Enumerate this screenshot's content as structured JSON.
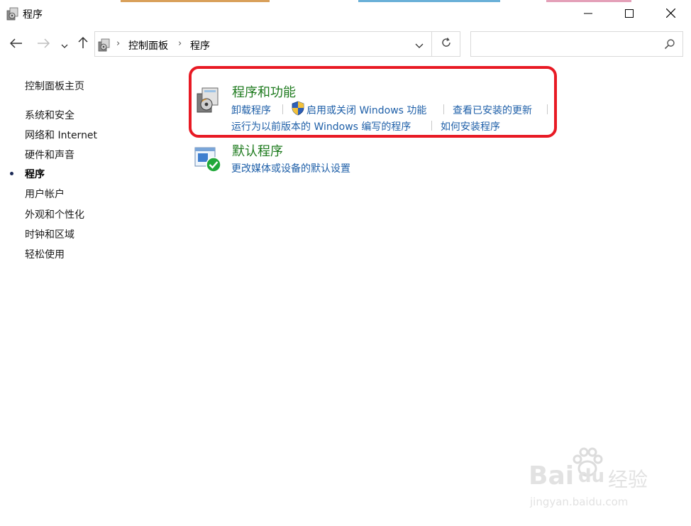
{
  "window": {
    "title": "程序"
  },
  "titlebar": {
    "minimize_icon": "minimize-icon",
    "maximize_icon": "maximize-icon",
    "close_icon": "close-icon"
  },
  "navbar": {
    "breadcrumbs": [
      "控制面板",
      "程序"
    ],
    "search_placeholder": ""
  },
  "sidebar": {
    "home": "控制面板主页",
    "items": [
      {
        "label": "系统和安全",
        "active": false
      },
      {
        "label": "网络和 Internet",
        "active": false
      },
      {
        "label": "硬件和声音",
        "active": false
      },
      {
        "label": "程序",
        "active": true
      },
      {
        "label": "用户帐户",
        "active": false
      },
      {
        "label": "外观和个性化",
        "active": false
      },
      {
        "label": "时钟和区域",
        "active": false
      },
      {
        "label": "轻松使用",
        "active": false
      }
    ]
  },
  "main": {
    "programs_features": {
      "title": "程序和功能",
      "links": [
        "卸载程序",
        "启用或关闭 Windows 功能",
        "查看已安装的更新",
        "运行为以前版本的 Windows 编写的程序",
        "如何安装程序"
      ]
    },
    "default_programs": {
      "title": "默认程序",
      "links": [
        "更改媒体或设备的默认设置"
      ]
    }
  },
  "watermark": {
    "brand": "Bai",
    "brand_suffix": "du",
    "cn": "经验",
    "url": "jingyan.baidu.com"
  },
  "colors": {
    "highlight": "#e81a24",
    "category_title": "#1d7a1d",
    "link": "#1e5fa8"
  }
}
